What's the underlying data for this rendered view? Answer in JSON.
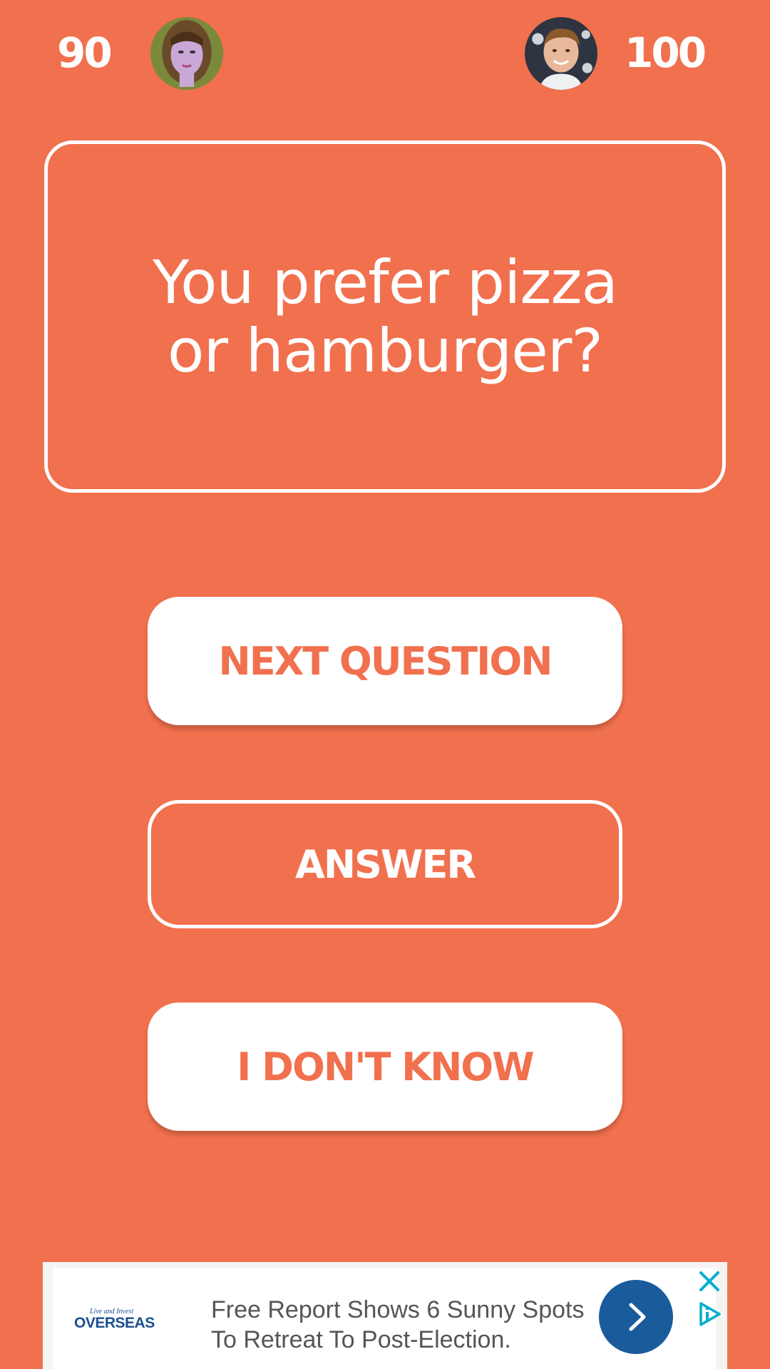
{
  "scores": {
    "player_left": "90",
    "player_right": "100"
  },
  "avatars": {
    "left": "avatar-woman",
    "right": "avatar-man"
  },
  "question": {
    "text": "You prefer pizza or hamburger?"
  },
  "buttons": {
    "next_question": "NEXT QUESTION",
    "answer": "ANSWER",
    "dont_know": "I DON'T KNOW"
  },
  "ad": {
    "logo_small": "Live and Invest",
    "logo_main": "OVERSEAS",
    "line1": "Free Report Shows 6 Sunny Spots",
    "line2": "To Retreat To Post-Election.",
    "cta_icon": "chevron-right-icon",
    "close_icon": "close-icon",
    "adchoices_icon": "adchoices-icon"
  },
  "colors": {
    "background": "#F1704E",
    "button_text": "#F1704E",
    "white": "#FFFFFF",
    "ad_cta": "#1A5B9C",
    "ad_close": "#00AECD"
  }
}
